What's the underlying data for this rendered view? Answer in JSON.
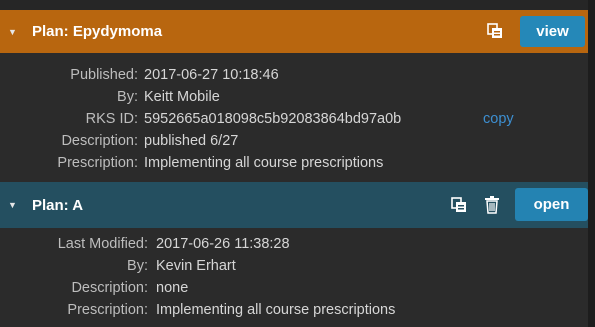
{
  "plans": [
    {
      "title": "Plan: Epydymoma",
      "action_label": "view",
      "fields": [
        {
          "label": "Published:",
          "value": "2017-06-27 10:18:46"
        },
        {
          "label": "By:",
          "value": "Keitt Mobile"
        },
        {
          "label": "RKS ID:",
          "value": "5952665a018098c5b92083864bd97a0b"
        },
        {
          "label": "Description:",
          "value": "published 6/27"
        },
        {
          "label": "Prescription:",
          "value": "Implementing all course prescriptions"
        }
      ],
      "copy_label": "copy"
    },
    {
      "title": "Plan: A",
      "action_label": "open",
      "fields": [
        {
          "label": "Last Modified:",
          "value": "2017-06-26 11:38:28"
        },
        {
          "label": "By:",
          "value": "Kevin Erhart"
        },
        {
          "label": "Description:",
          "value": "none"
        },
        {
          "label": "Prescription:",
          "value": "Implementing all course prescriptions"
        }
      ]
    }
  ],
  "colors": {
    "plan1_header": "#b8660f",
    "plan2_header": "#244f60",
    "button": "#2588b8",
    "link": "#3d8fd1"
  },
  "icons": {
    "toggle": "triangle-down-icon",
    "duplicate": "duplicate-icon",
    "delete": "trash-icon"
  }
}
